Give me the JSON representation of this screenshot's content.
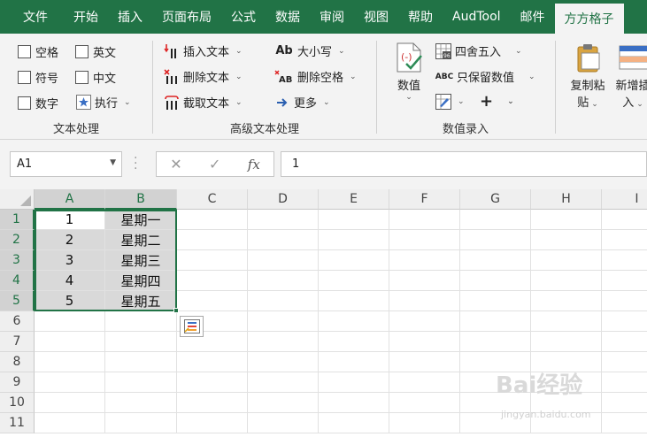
{
  "tabs": [
    "文件",
    "开始",
    "插入",
    "页面布局",
    "公式",
    "数据",
    "审阅",
    "视图",
    "帮助",
    "AudTool",
    "邮件",
    "方方格子"
  ],
  "active_tab_index": 11,
  "ribbon": {
    "group_text": {
      "label": "文本处理",
      "checkboxes": [
        "空格",
        "英文",
        "符号",
        "中文",
        "数字"
      ],
      "execute": "执行"
    },
    "group_adv": {
      "label": "高级文本处理",
      "insert_text": "插入文本",
      "delete_text": "删除文本",
      "extract_text": "截取文本",
      "case": "大小写",
      "delete_space": "删除空格",
      "more": "更多"
    },
    "group_num": {
      "label": "数值录入",
      "value": "数值",
      "round": "四舍五入",
      "keep_value": "只保留数值"
    },
    "group_paste": {
      "copy_paste_line1": "复制粘",
      "copy_paste_line2": "贴",
      "new_insert_line1": "新增插",
      "new_insert_line2": "入"
    }
  },
  "formula_bar": {
    "name_box": "A1",
    "formula": "1"
  },
  "grid": {
    "columns": [
      "A",
      "B",
      "C",
      "D",
      "E",
      "F",
      "G",
      "H",
      "I"
    ],
    "rows": [
      "1",
      "2",
      "3",
      "4",
      "5",
      "6",
      "7",
      "8",
      "9",
      "10",
      "11"
    ],
    "cells_a": [
      "1",
      "2",
      "3",
      "4",
      "5"
    ],
    "cells_b": [
      "星期一",
      "星期二",
      "星期三",
      "星期四",
      "星期五"
    ]
  },
  "watermark": "Bai经验",
  "watermark_sub": "jingyan.baidu.com",
  "colors": {
    "accent": "#217346",
    "ribbon_bg": "#f3f3f3",
    "selection_fill": "#d9d9d9"
  }
}
